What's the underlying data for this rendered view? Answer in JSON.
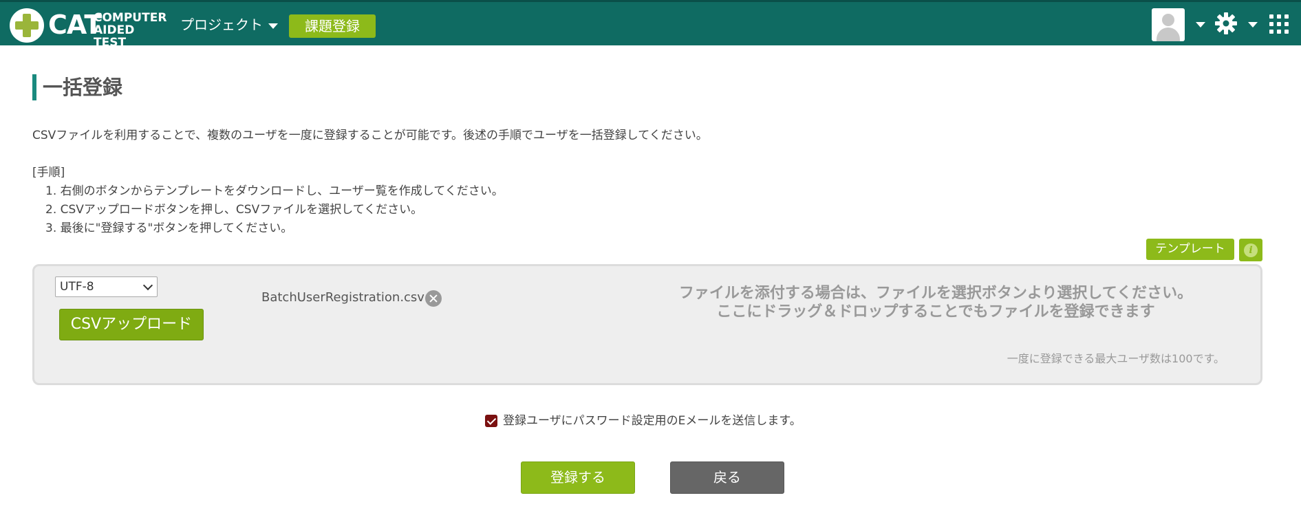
{
  "header": {
    "logo_text": "CAT",
    "logo_subtext": "COMPUTER AIDED TEST",
    "project_menu_label": "プロジェクト",
    "task_register_label": "課題登録"
  },
  "page": {
    "title": "一括登録",
    "description": "CSVファイルを利用することで、複数のユーザを一度に登録することが可能です。後述の手順でユーザを一括登録してください。",
    "steps_label": "[手順]",
    "steps": [
      "1. 右側のボタンからテンプレートをダウンロードし、ユーザー覧を作成してください。",
      "2. CSVアップロードボタンを押し、CSVファイルを選択してください。",
      "3. 最後に\"登録する\"ボタンを押してください。"
    ]
  },
  "template_button_label": "テンプレート",
  "info_button_glyph": "i",
  "upload": {
    "encoding_value": "UTF-8",
    "csv_upload_label": "CSVアップロード",
    "filename": "BatchUserRegistration.csv",
    "drop_message_line1": "ファイルを添付する場合は、ファイルを選択ボタンより選択してください。",
    "drop_message_line2": "ここにドラッグ＆ドロップすることでもファイルを登録できます",
    "max_users_note": "一度に登録できる最大ユーザ数は100です。"
  },
  "options": {
    "send_email_label": "登録ユーザにパスワード設定用のEメールを送信します。",
    "send_email_checked": true
  },
  "actions": {
    "register_label": "登録する",
    "back_label": "戻る"
  },
  "colors": {
    "header_bg": "#0f6b62",
    "accent_green": "#8dba1a",
    "back_button": "#666666",
    "checkbox": "#7a1010"
  }
}
